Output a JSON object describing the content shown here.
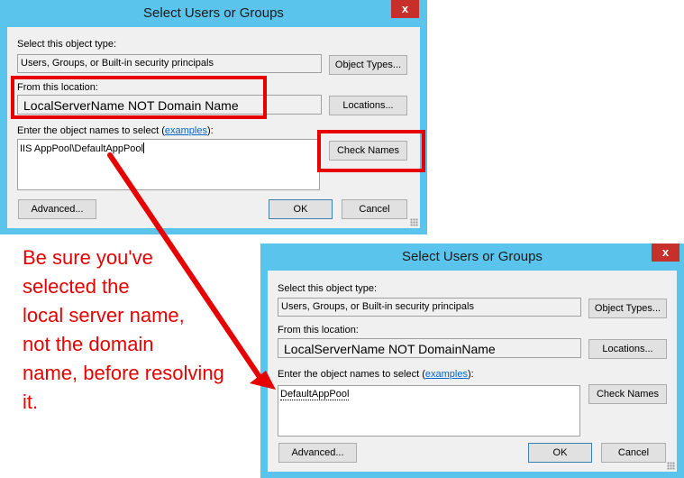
{
  "dialog1": {
    "title": "Select Users or Groups",
    "close_glyph": "x",
    "object_type_label": "Select this object type:",
    "object_type_value": "Users, Groups, or Built-in security principals",
    "object_types_button": "Object Types...",
    "location_label": "From this location:",
    "location_value": "LocalServerName NOT Domain Name",
    "locations_button": "Locations...",
    "names_label_prefix": "Enter the object names to select (",
    "names_label_link": "examples",
    "names_label_suffix": "):",
    "names_value": "IIS AppPool\\DefaultAppPool",
    "check_names_button": "Check Names",
    "advanced_button": "Advanced...",
    "ok_button": "OK",
    "cancel_button": "Cancel"
  },
  "dialog2": {
    "title": "Select Users or Groups",
    "close_glyph": "x",
    "object_type_label": "Select this object type:",
    "object_type_value": "Users, Groups, or Built-in security principals",
    "object_types_button": "Object Types...",
    "location_label": "From this location:",
    "location_value": "LocalServerName NOT DomainName",
    "locations_button": "Locations...",
    "names_label_prefix": "Enter the object names to select (",
    "names_label_link": "examples",
    "names_label_suffix": "):",
    "names_value": "DefaultAppPool",
    "check_names_button": "Check Names",
    "advanced_button": "Advanced...",
    "ok_button": "OK",
    "cancel_button": "Cancel"
  },
  "annotation": {
    "lines": [
      "Be sure you've",
      "selected the",
      "local server name,",
      "not the domain",
      "name, before resolving",
      "it."
    ],
    "color": "#e60000"
  },
  "colors": {
    "dialog_frame": "#5bc4ec",
    "close_button": "#c7302a",
    "highlight": "#e60000"
  }
}
